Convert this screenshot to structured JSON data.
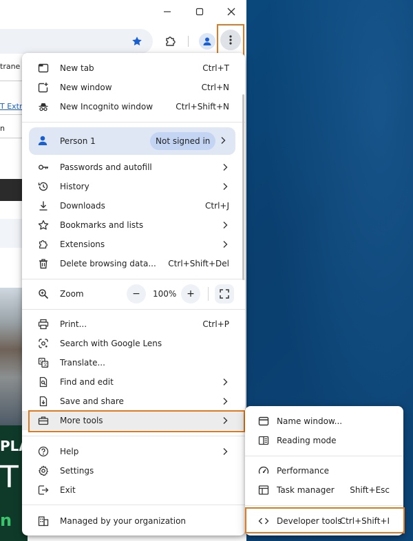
{
  "window": {
    "minimize_icon": "minimize-icon",
    "maximize_icon": "maximize-icon",
    "close_icon": "close-icon"
  },
  "toolbar": {
    "bookmark_icon": "star-icon",
    "extensions_icon": "puzzle-icon",
    "profile_icon": "person-icon",
    "menu_icon": "three-dots-vertical-icon"
  },
  "page_fragments": {
    "text1": "trane",
    "text2": "T Extra",
    "text3": "n",
    "big1": "PLA",
    "big2": "T",
    "big3": "n"
  },
  "menu": {
    "new_tab": {
      "label": "New tab",
      "shortcut": "Ctrl+T"
    },
    "new_window": {
      "label": "New window",
      "shortcut": "Ctrl+N"
    },
    "incognito": {
      "label": "New Incognito window",
      "shortcut": "Ctrl+Shift+N"
    },
    "profile": {
      "name": "Person 1",
      "status": "Not signed in"
    },
    "passwords": {
      "label": "Passwords and autofill"
    },
    "history": {
      "label": "History"
    },
    "downloads": {
      "label": "Downloads",
      "shortcut": "Ctrl+J"
    },
    "bookmarks": {
      "label": "Bookmarks and lists"
    },
    "extensions": {
      "label": "Extensions"
    },
    "delete_data": {
      "label": "Delete browsing data...",
      "shortcut": "Ctrl+Shift+Del"
    },
    "zoom": {
      "label": "Zoom",
      "minus": "−",
      "value": "100%",
      "plus": "+"
    },
    "print": {
      "label": "Print...",
      "shortcut": "Ctrl+P"
    },
    "lens": {
      "label": "Search with Google Lens"
    },
    "translate": {
      "label": "Translate..."
    },
    "find_edit": {
      "label": "Find and edit"
    },
    "save_share": {
      "label": "Save and share"
    },
    "more_tools": {
      "label": "More tools"
    },
    "help": {
      "label": "Help"
    },
    "settings": {
      "label": "Settings"
    },
    "exit": {
      "label": "Exit"
    },
    "managed": {
      "label": "Managed by your organization"
    }
  },
  "submenu": {
    "name_window": {
      "label": "Name window..."
    },
    "reading_mode": {
      "label": "Reading mode"
    },
    "performance": {
      "label": "Performance"
    },
    "task_manager": {
      "label": "Task manager",
      "shortcut": "Shift+Esc"
    },
    "developer_tools": {
      "label": "Developer tools",
      "shortcut": "Ctrl+Shift+I"
    }
  },
  "colors": {
    "highlight": "#e07a20",
    "accent": "#1a73e8",
    "desktop": "#0b4f86"
  }
}
